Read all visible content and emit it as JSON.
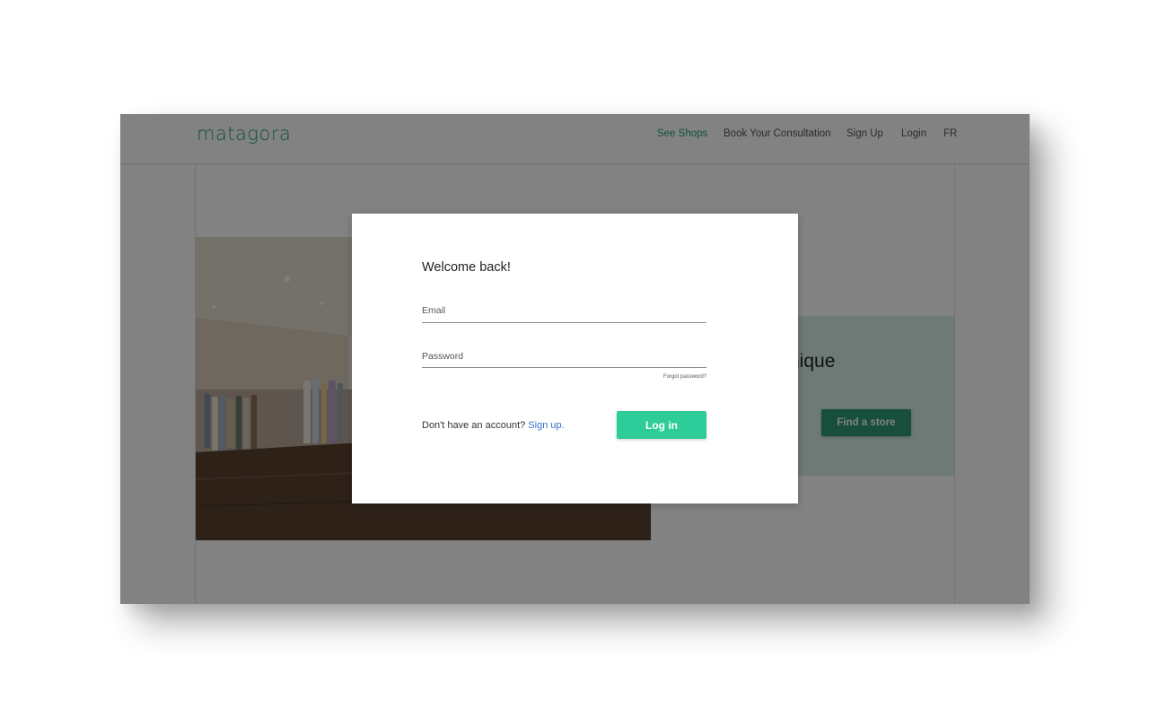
{
  "header": {
    "logo": "matagora",
    "nav": [
      "See Shops",
      "Book Your Consultation",
      "Sign Up",
      "Login",
      "FR"
    ]
  },
  "background": {
    "headline_fragment": "nique",
    "find_store_label": "Find a store"
  },
  "modal": {
    "title": "Welcome back!",
    "email_label": "Email",
    "password_label": "Password",
    "forgot_password": "Forgot password?",
    "no_account_text": "Don't have an account?",
    "sign_up_link": "Sign up.",
    "login_button": "Log in"
  },
  "colors": {
    "brand_green": "#2ecc99",
    "nav_active": "#22a27a",
    "button_dark_green": "#2d9b73",
    "link_blue": "#3b6fc9"
  },
  "icons": {
    "store_photo": "clothing-boutique-photo"
  }
}
